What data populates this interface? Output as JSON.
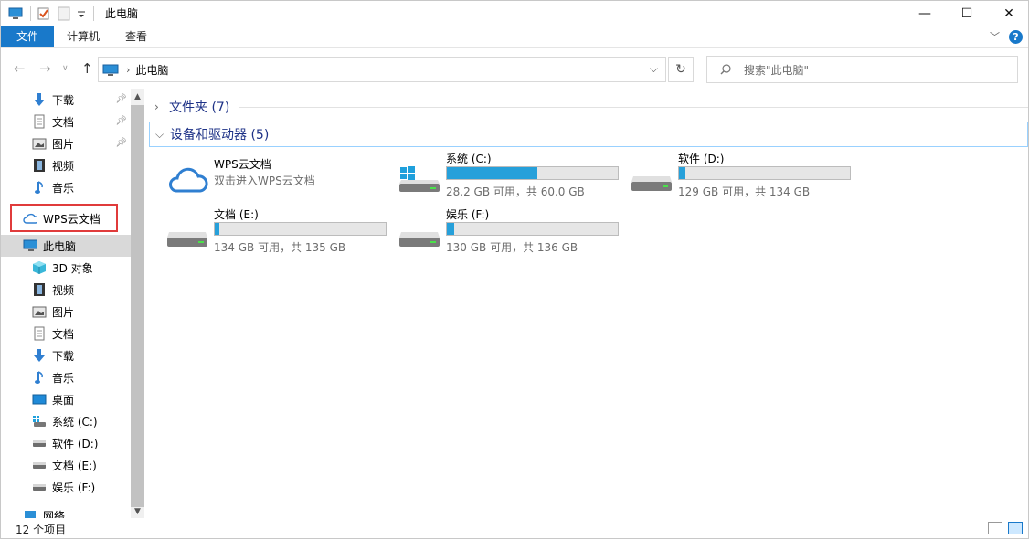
{
  "window": {
    "title": "此电脑"
  },
  "ribbon": {
    "tabs": [
      "文件",
      "计算机",
      "查看"
    ]
  },
  "address": {
    "crumb": "此电脑"
  },
  "search": {
    "placeholder": "搜索\"此电脑\""
  },
  "sidebar": {
    "quick": [
      {
        "label": "下载",
        "icon": "download-icon",
        "pinned": true
      },
      {
        "label": "文档",
        "icon": "document-icon",
        "pinned": true
      },
      {
        "label": "图片",
        "icon": "picture-icon",
        "pinned": true
      },
      {
        "label": "视频",
        "icon": "video-icon",
        "pinned": false
      },
      {
        "label": "音乐",
        "icon": "music-icon",
        "pinned": false
      }
    ],
    "wps": "WPS云文档",
    "this_pc": "此电脑",
    "pc_items": [
      {
        "label": "3D 对象",
        "icon": "cube-icon"
      },
      {
        "label": "视频",
        "icon": "video-icon"
      },
      {
        "label": "图片",
        "icon": "picture-icon"
      },
      {
        "label": "文档",
        "icon": "document-icon"
      },
      {
        "label": "下载",
        "icon": "download-icon"
      },
      {
        "label": "音乐",
        "icon": "music-icon"
      },
      {
        "label": "桌面",
        "icon": "desktop-icon"
      },
      {
        "label": "系统 (C:)",
        "icon": "system-drive-icon"
      },
      {
        "label": "软件 (D:)",
        "icon": "drive-icon"
      },
      {
        "label": "文档 (E:)",
        "icon": "drive-icon"
      },
      {
        "label": "娱乐 (F:)",
        "icon": "drive-icon"
      }
    ],
    "network": "网络"
  },
  "groups": {
    "folders": "文件夹 (7)",
    "drives": "设备和驱动器 (5)"
  },
  "cloud": {
    "name": "WPS云文档",
    "sub": "双击进入WPS云文档"
  },
  "drives": [
    {
      "name": "系统 (C:)",
      "info": "28.2 GB 可用，共 60.0 GB",
      "used": 0.53,
      "system": true
    },
    {
      "name": "软件 (D:)",
      "info": "129 GB 可用，共 134 GB",
      "used": 0.037
    },
    {
      "name": "文档 (E:)",
      "info": "134 GB 可用，共 135 GB",
      "used": 0.007
    },
    {
      "name": "娱乐 (F:)",
      "info": "130 GB 可用，共 136 GB",
      "used": 0.044
    }
  ],
  "status": {
    "count": "12 个项目"
  },
  "colors": {
    "accent": "#1979ca",
    "bar_fill": "#26a0da",
    "highlight": "#e03b3b"
  }
}
